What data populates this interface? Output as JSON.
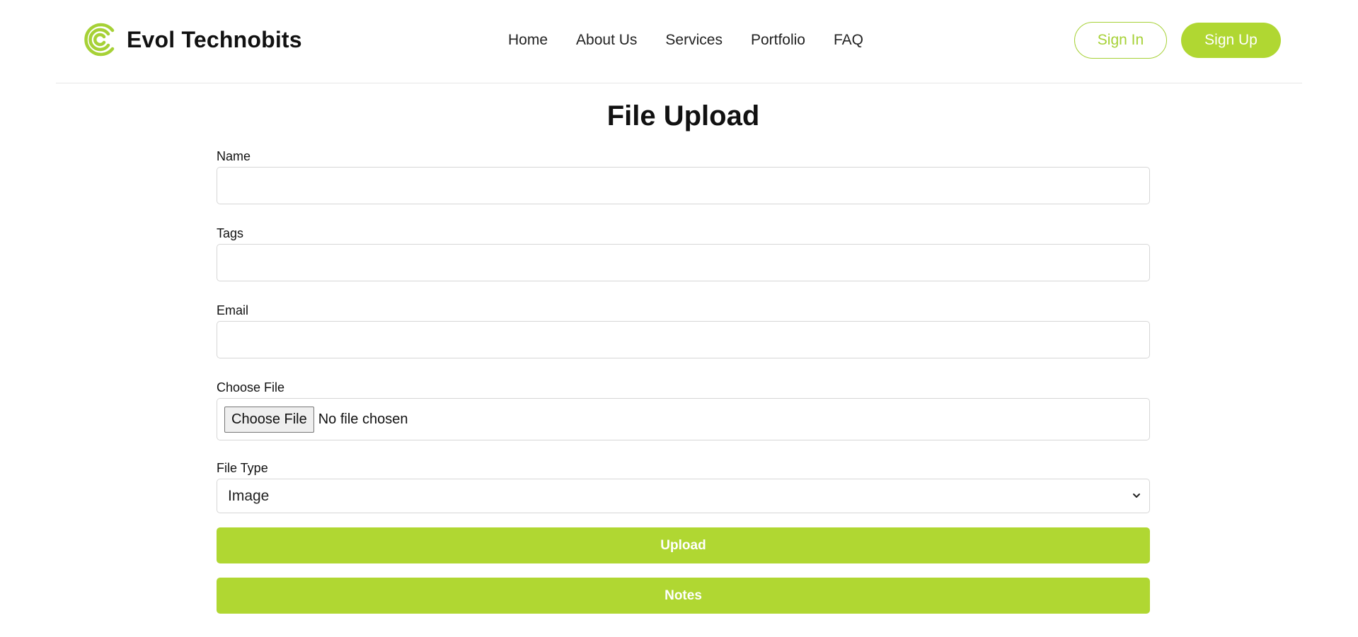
{
  "brand": {
    "name": "Evol Technobits",
    "logo_icon": "concentric-arcs-logo-icon",
    "accent_color": "#b0d732"
  },
  "nav": {
    "items": [
      {
        "label": "Home"
      },
      {
        "label": "About Us"
      },
      {
        "label": "Services"
      },
      {
        "label": "Portfolio"
      },
      {
        "label": "FAQ"
      }
    ]
  },
  "auth": {
    "sign_in_label": "Sign In",
    "sign_up_label": "Sign Up"
  },
  "page": {
    "title": "File Upload"
  },
  "form": {
    "name_label": "Name",
    "name_value": "",
    "tags_label": "Tags",
    "tags_value": "",
    "email_label": "Email",
    "email_value": "",
    "file_label": "Choose File",
    "file_button_label": "Choose File",
    "file_status": "No file chosen",
    "file_type_label": "File Type",
    "file_type_selected": "Image",
    "upload_label": "Upload",
    "notes_label": "Notes"
  }
}
